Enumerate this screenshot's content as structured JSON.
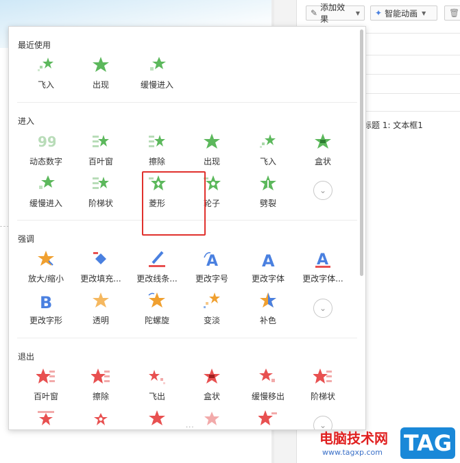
{
  "toolbar": {
    "add_effect": "添加效果",
    "smart_animation": "智能动画"
  },
  "panel": {
    "item_label": "标题 1: 文本框1"
  },
  "popup": {
    "recent": {
      "title": "最近使用",
      "items": [
        "飞入",
        "出现",
        "缓慢进入"
      ]
    },
    "entrance": {
      "title": "进入",
      "items": [
        "动态数字",
        "百叶窗",
        "擦除",
        "出现",
        "飞入",
        "盒状",
        "缓慢进入",
        "阶梯状",
        "菱形",
        "轮子",
        "劈裂"
      ]
    },
    "emphasis": {
      "title": "强调",
      "items": [
        "放大/缩小",
        "更改填充...",
        "更改线条...",
        "更改字号",
        "更改字体",
        "更改字体...",
        "更改字形",
        "透明",
        "陀螺旋",
        "变淡",
        "补色"
      ]
    },
    "exit": {
      "title": "退出",
      "items": [
        "百叶窗",
        "擦除",
        "飞出",
        "盒状",
        "缓慢移出",
        "阶梯状"
      ]
    }
  },
  "watermark": {
    "name": "电脑技术网",
    "url": "www.tagxp.com",
    "tag": "TAG"
  },
  "colors": {
    "entrance": "#5cb85c",
    "emphasis_orange": "#f0a030",
    "emphasis_blue": "#4a80e0",
    "exit": "#e85050",
    "highlight": "#e0302c"
  }
}
